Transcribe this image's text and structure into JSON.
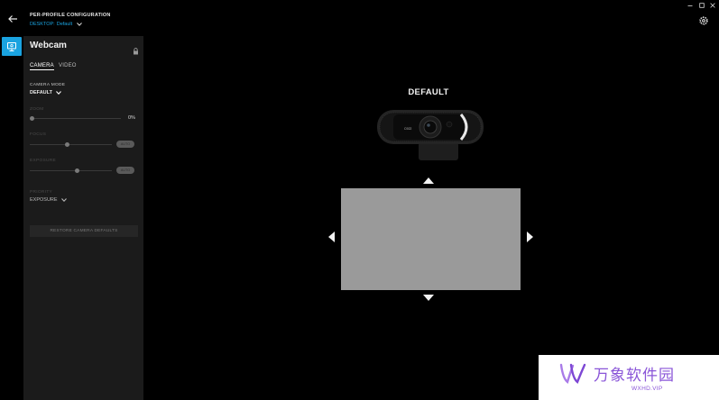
{
  "header": {
    "profile_label": "PER-PROFILE CONFIGURATION",
    "profile_prefix": "DESKTOP:",
    "profile_name": "Default"
  },
  "panel": {
    "title": "Webcam",
    "tabs": [
      {
        "label": "CAMERA",
        "active": true
      },
      {
        "label": "VIDEO",
        "active": false
      }
    ],
    "camera_mode": {
      "label": "CAMERA MODE",
      "value": "DEFAULT"
    },
    "zoom": {
      "label": "ZOOM",
      "value_text": "0%",
      "level": 0.0
    },
    "focus": {
      "label": "FOCUS",
      "level": 0.45,
      "auto_label": "AUTO"
    },
    "exposure": {
      "label": "EXPOSURE",
      "level": 0.58,
      "auto_label": "AUTO"
    },
    "priority": {
      "label": "PRIORITY",
      "value": "EXPOSURE"
    },
    "restore_button": "RESTORE CAMERA DEFAULTS"
  },
  "preview": {
    "heading": "DEFAULT",
    "webcam_badge": "C922"
  },
  "watermark": {
    "name": "万象软件园",
    "url": "WXHD.VIP"
  },
  "colors": {
    "accent": "#1aa3e0",
    "panel_bg": "#1b1b1b",
    "preview_box": "#9a9a9a",
    "watermark": "#8a55d8"
  },
  "icons": [
    "back-arrow-icon",
    "gear-icon",
    "monitor-icon",
    "lock-icon",
    "chevron-down-icon",
    "minimize-icon",
    "maximize-icon",
    "close-icon"
  ]
}
